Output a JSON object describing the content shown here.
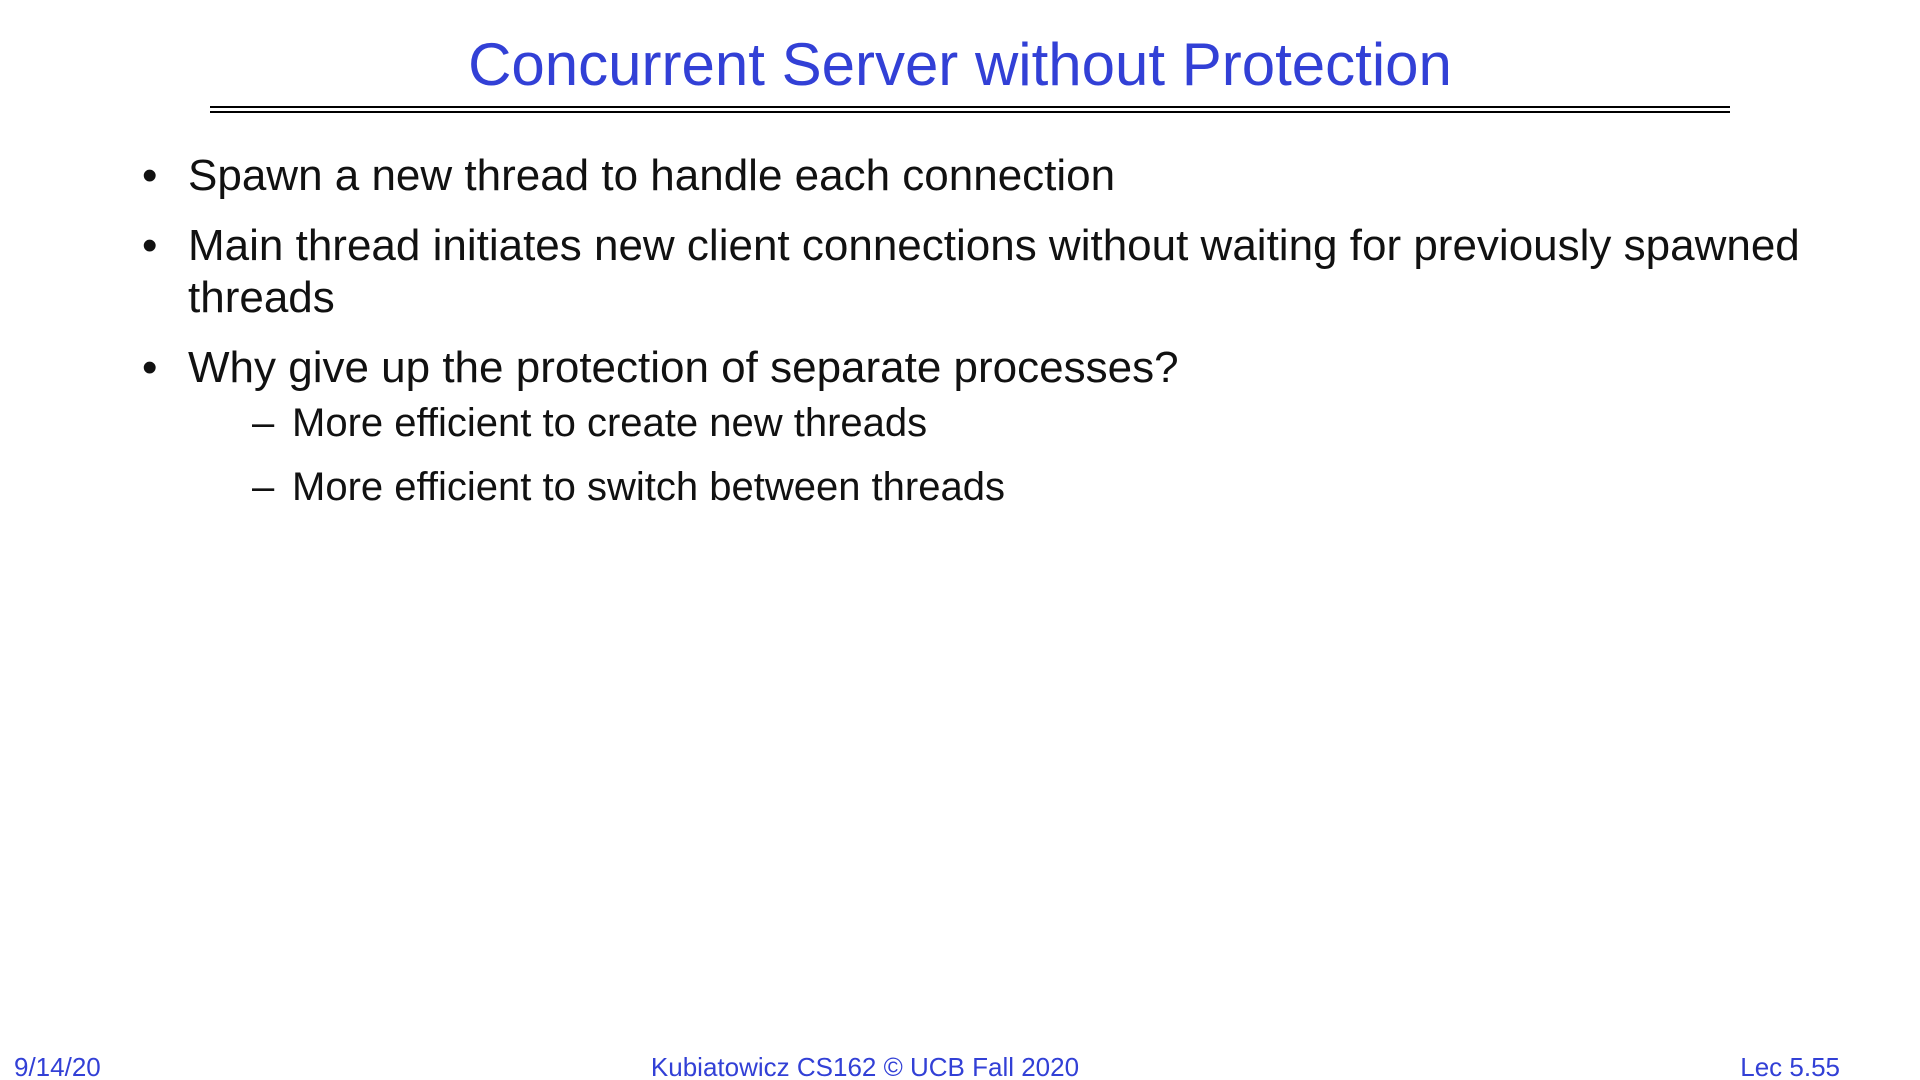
{
  "slide": {
    "title": "Concurrent Server without Protection",
    "bullets": [
      "Spawn a new thread to handle each connection",
      "Main thread initiates new client connections without waiting for previously spawned threads",
      "Why give up the protection of separate processes?"
    ],
    "subbullets": [
      "More efficient to create new threads",
      "More efficient to switch between threads"
    ],
    "sub_marker": "–",
    "colors": {
      "title": "#3240d6",
      "body_text": "#111111",
      "footer": "#3240d6"
    }
  },
  "footer": {
    "date": "9/14/20",
    "course": "Kubiatowicz CS162 © UCB Fall 2020",
    "lecture": "Lec 5.55"
  }
}
